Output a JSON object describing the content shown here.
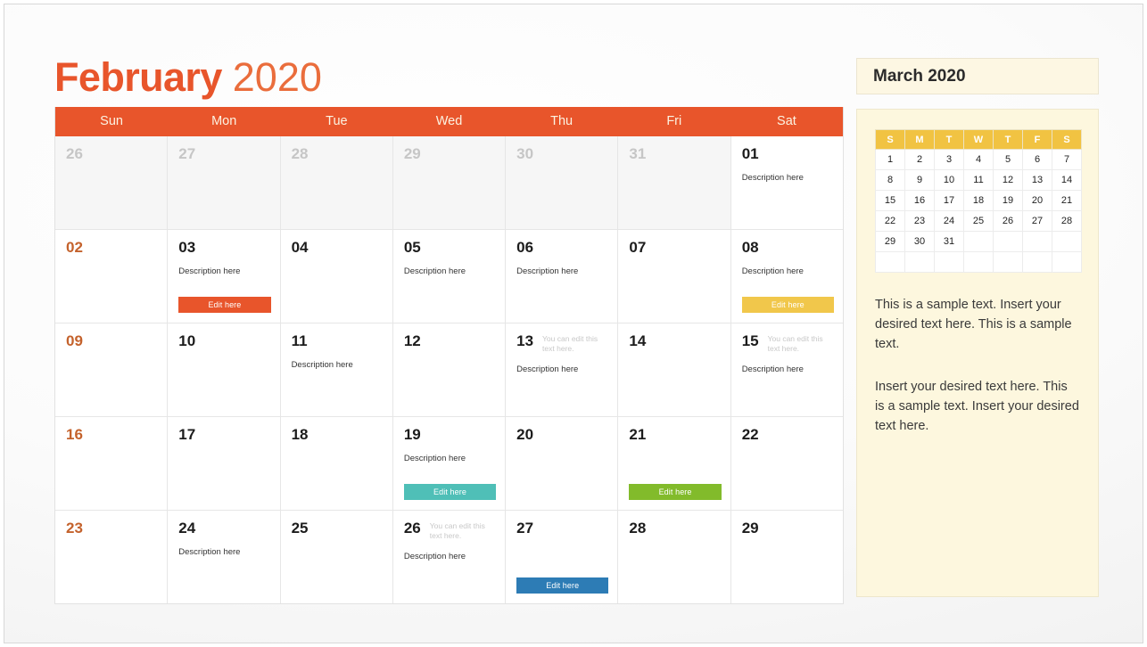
{
  "title": {
    "month": "February",
    "year": "2020"
  },
  "calendar": {
    "day_headers": [
      "Sun",
      "Mon",
      "Tue",
      "Wed",
      "Thu",
      "Fri",
      "Sat"
    ],
    "edit_note": "You can edit this text here.",
    "description_label": "Description here",
    "edit_button_label": "Edit here",
    "colors": {
      "header_bg": "#E8552B",
      "header_text": "#FCF3E2",
      "sunday_date": "#C4622C",
      "muted_date": "#c6c6c6",
      "btn_orange": "#E8552B",
      "btn_yellow": "#F1C74B",
      "btn_teal": "#4FBFB7",
      "btn_green": "#82BB2B",
      "btn_blue": "#2D7CB5"
    },
    "weeks": [
      [
        {
          "num": "26",
          "muted": true
        },
        {
          "num": "27",
          "muted": true
        },
        {
          "num": "28",
          "muted": true
        },
        {
          "num": "29",
          "muted": true
        },
        {
          "num": "30",
          "muted": true
        },
        {
          "num": "31",
          "muted": true
        },
        {
          "num": "01",
          "desc": "Description here"
        }
      ],
      [
        {
          "num": "02",
          "sunday": true
        },
        {
          "num": "03",
          "desc": "Description here",
          "button": "Edit here",
          "button_color": "orange"
        },
        {
          "num": "04"
        },
        {
          "num": "05",
          "desc": "Description here"
        },
        {
          "num": "06",
          "desc": "Description here"
        },
        {
          "num": "07"
        },
        {
          "num": "08",
          "desc": "Description here",
          "button": "Edit here",
          "button_color": "yellow"
        }
      ],
      [
        {
          "num": "09",
          "sunday": true
        },
        {
          "num": "10"
        },
        {
          "num": "11",
          "desc": "Description here"
        },
        {
          "num": "12"
        },
        {
          "num": "13",
          "note": "You can edit this text here.",
          "desc": "Description here"
        },
        {
          "num": "14"
        },
        {
          "num": "15",
          "note": "You can edit this text here.",
          "desc": "Description here"
        }
      ],
      [
        {
          "num": "16",
          "sunday": true
        },
        {
          "num": "17"
        },
        {
          "num": "18"
        },
        {
          "num": "19",
          "desc": "Description here",
          "button": "Edit here",
          "button_color": "teal"
        },
        {
          "num": "20"
        },
        {
          "num": "21",
          "button": "Edit here",
          "button_color": "green"
        },
        {
          "num": "22"
        }
      ],
      [
        {
          "num": "23",
          "sunday": true
        },
        {
          "num": "24",
          "desc": "Description here"
        },
        {
          "num": "25"
        },
        {
          "num": "26",
          "note": "You can edit this text here.",
          "desc": "Description here"
        },
        {
          "num": "27",
          "button": "Edit here",
          "button_color": "blue"
        },
        {
          "num": "28"
        },
        {
          "num": "29"
        }
      ]
    ]
  },
  "sidebar": {
    "title": "March 2020",
    "mini_calendar": {
      "day_headers": [
        "S",
        "M",
        "T",
        "W",
        "T",
        "F",
        "S"
      ],
      "weeks": [
        [
          "1",
          "2",
          "3",
          "4",
          "5",
          "6",
          "7"
        ],
        [
          "8",
          "9",
          "10",
          "11",
          "12",
          "13",
          "14"
        ],
        [
          "15",
          "16",
          "17",
          "18",
          "19",
          "20",
          "21"
        ],
        [
          "22",
          "23",
          "24",
          "25",
          "26",
          "27",
          "28"
        ],
        [
          "29",
          "30",
          "31",
          "",
          "",
          "",
          ""
        ],
        [
          "",
          "",
          "",
          "",
          "",
          "",
          ""
        ]
      ]
    },
    "paragraph1": "This is a sample text. Insert your desired text here. This is a sample text.",
    "paragraph2": "Insert your desired text here. This is a sample text. Insert your desired text here."
  }
}
